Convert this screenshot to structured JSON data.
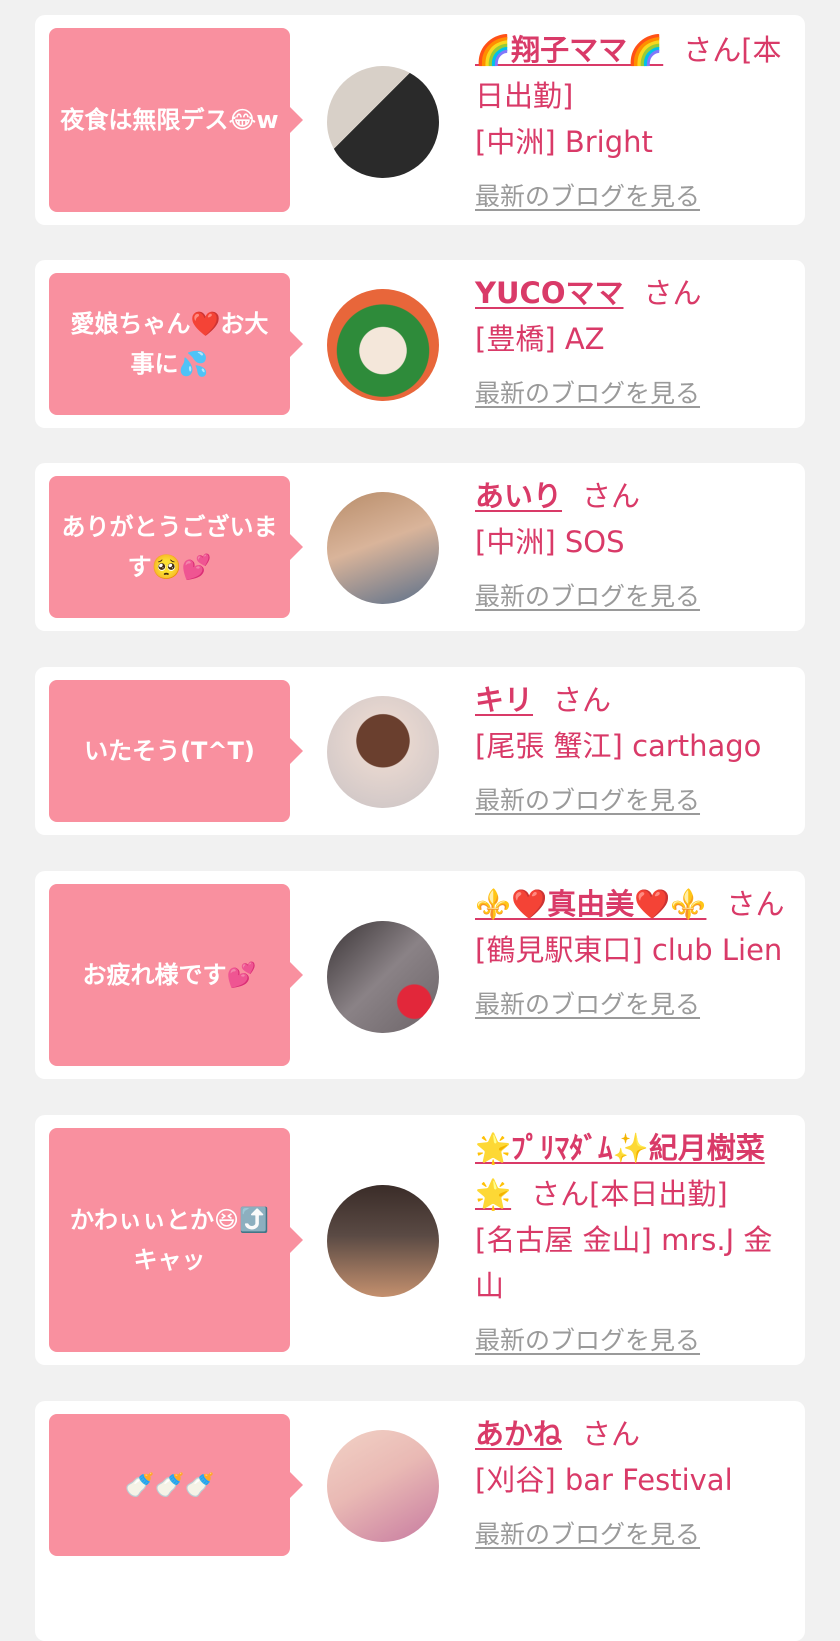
{
  "cards": [
    {
      "message": "夜食は無限デス😂w",
      "name": "🌈翔子ママ🌈",
      "san": "さん[本日出勤]",
      "shop": "[中洲] Bright",
      "blog_link": "最新のブログを見る",
      "avatar_colors": [
        "#2a2a2a",
        "#d8d0c8"
      ]
    },
    {
      "message": "愛娘ちゃん❤️お大事に💦",
      "name": "YUCOママ",
      "san": "さん",
      "shop": "[豊橋] AZ",
      "blog_link": "最新のブログを見る",
      "avatar_colors": [
        "#2e8b3a",
        "#e8663a"
      ]
    },
    {
      "message": "ありがとうございます🥺💕",
      "name": "あいり",
      "san": "さん",
      "shop": "[中洲] SOS",
      "blog_link": "最新のブログを見る",
      "avatar_colors": [
        "#b88d6a",
        "#5a6f8a"
      ]
    },
    {
      "message": "いたそう(T^T)",
      "name": "キリ",
      "san": "さん",
      "shop": "[尾張 蟹江] carthago",
      "blog_link": "最新のブログを見る",
      "avatar_colors": [
        "#c9c2c4",
        "#6a3f2e"
      ]
    },
    {
      "message": "お疲れ様です💕",
      "name": "⚜️❤️真由美❤️⚜️",
      "san": "さん",
      "shop": "[鶴見駅東口] club Lien",
      "blog_link": "最新のブログを見る",
      "avatar_colors": [
        "#6c6468",
        "#e2273a"
      ]
    },
    {
      "message": "かわぃぃとか😆⤴️キャッ",
      "name": "🌟ﾌﾟﾘﾏﾀﾞﾑ✨紀月樹菜🌟",
      "san": "さん[本日出勤]",
      "shop": "[名古屋 金山] mrs.J 金山",
      "blog_link": "最新のブログを見る",
      "avatar_colors": [
        "#3a2c28",
        "#c4906e"
      ]
    },
    {
      "message": "🍼🍼🍼",
      "name": "あかね",
      "san": "さん",
      "shop": "[刈谷] bar Festival",
      "blog_link": "最新のブログを見る",
      "avatar_colors": [
        "#e9b9b4",
        "#c77aa0"
      ]
    }
  ]
}
